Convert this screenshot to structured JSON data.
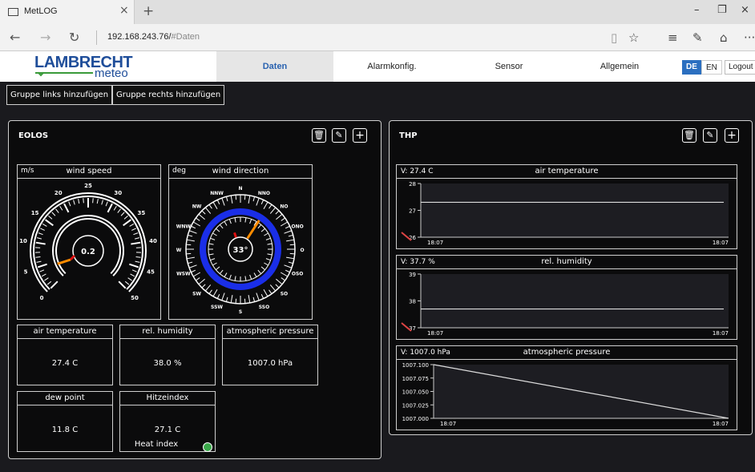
{
  "browser": {
    "tab_title": "MetLOG",
    "tab_close": "×",
    "new_tab": "+",
    "url_host": "192.168.243.76/",
    "url_hash": "#Daten",
    "minimize": "–",
    "restore": "❐",
    "close": "×",
    "back": "←",
    "forward": "→",
    "refresh": "↻",
    "reading": "📖",
    "favorite": "☆",
    "hub": "≡",
    "notes": "✎",
    "share": "⛭",
    "more": "···"
  },
  "app": {
    "logo_main": "LAMBRECHT",
    "logo_sub": "meteo",
    "nav": [
      "Daten",
      "Alarmkonfig.",
      "Sensor",
      "Allgemein"
    ],
    "lang_de": "DE",
    "lang_en": "EN",
    "logout": "Logout",
    "add_left": "Gruppe links hinzufügen",
    "add_right": "Gruppe rechts hinzufügen"
  },
  "eolos": {
    "title": "EOLOS",
    "wind_speed": {
      "unit": "m/s",
      "title": "wind speed",
      "value": "0.2",
      "ticks": [
        "0",
        "5",
        "10",
        "15",
        "20",
        "25",
        "30",
        "35",
        "40",
        "45",
        "50"
      ]
    },
    "wind_dir": {
      "unit": "deg",
      "title": "wind direction",
      "value": "33°",
      "labels": [
        "N",
        "NNO",
        "NO",
        "ONO",
        "O",
        "OSO",
        "SO",
        "SSO",
        "S",
        "SSW",
        "SW",
        "WSW",
        "W",
        "WNW",
        "NW",
        "NNW"
      ]
    },
    "cards": [
      {
        "title": "air temperature",
        "value": "27.4 C"
      },
      {
        "title": "rel. humidity",
        "value": "38.0 %"
      },
      {
        "title": "atmospheric pressure",
        "value": "1007.0 hPa"
      },
      {
        "title": "dew point",
        "value": "11.8 C"
      },
      {
        "title": "Hitzeindex",
        "value": "27.1 C",
        "extra": "Heat index"
      }
    ]
  },
  "thp": {
    "title": "THP",
    "charts": [
      {
        "value": "V: 27.4 C",
        "title": "air temperature",
        "yticks": [
          "28",
          "27",
          "26"
        ],
        "xstart": "18:07",
        "xend": "18:07"
      },
      {
        "value": "V: 37.7 %",
        "title": "rel. humidity",
        "yticks": [
          "39",
          "38",
          "37"
        ],
        "xstart": "18:07",
        "xend": "18:07"
      },
      {
        "value": "V: 1007.0 hPa",
        "title": "atmospheric pressure",
        "yticks": [
          "1007.100",
          "1007.075",
          "1007.050",
          "1007.025",
          "1007.000"
        ],
        "xstart": "18:07",
        "xend": "18:07"
      }
    ]
  },
  "icons": {
    "delete": "🗑",
    "edit": "✎",
    "add": "+"
  }
}
